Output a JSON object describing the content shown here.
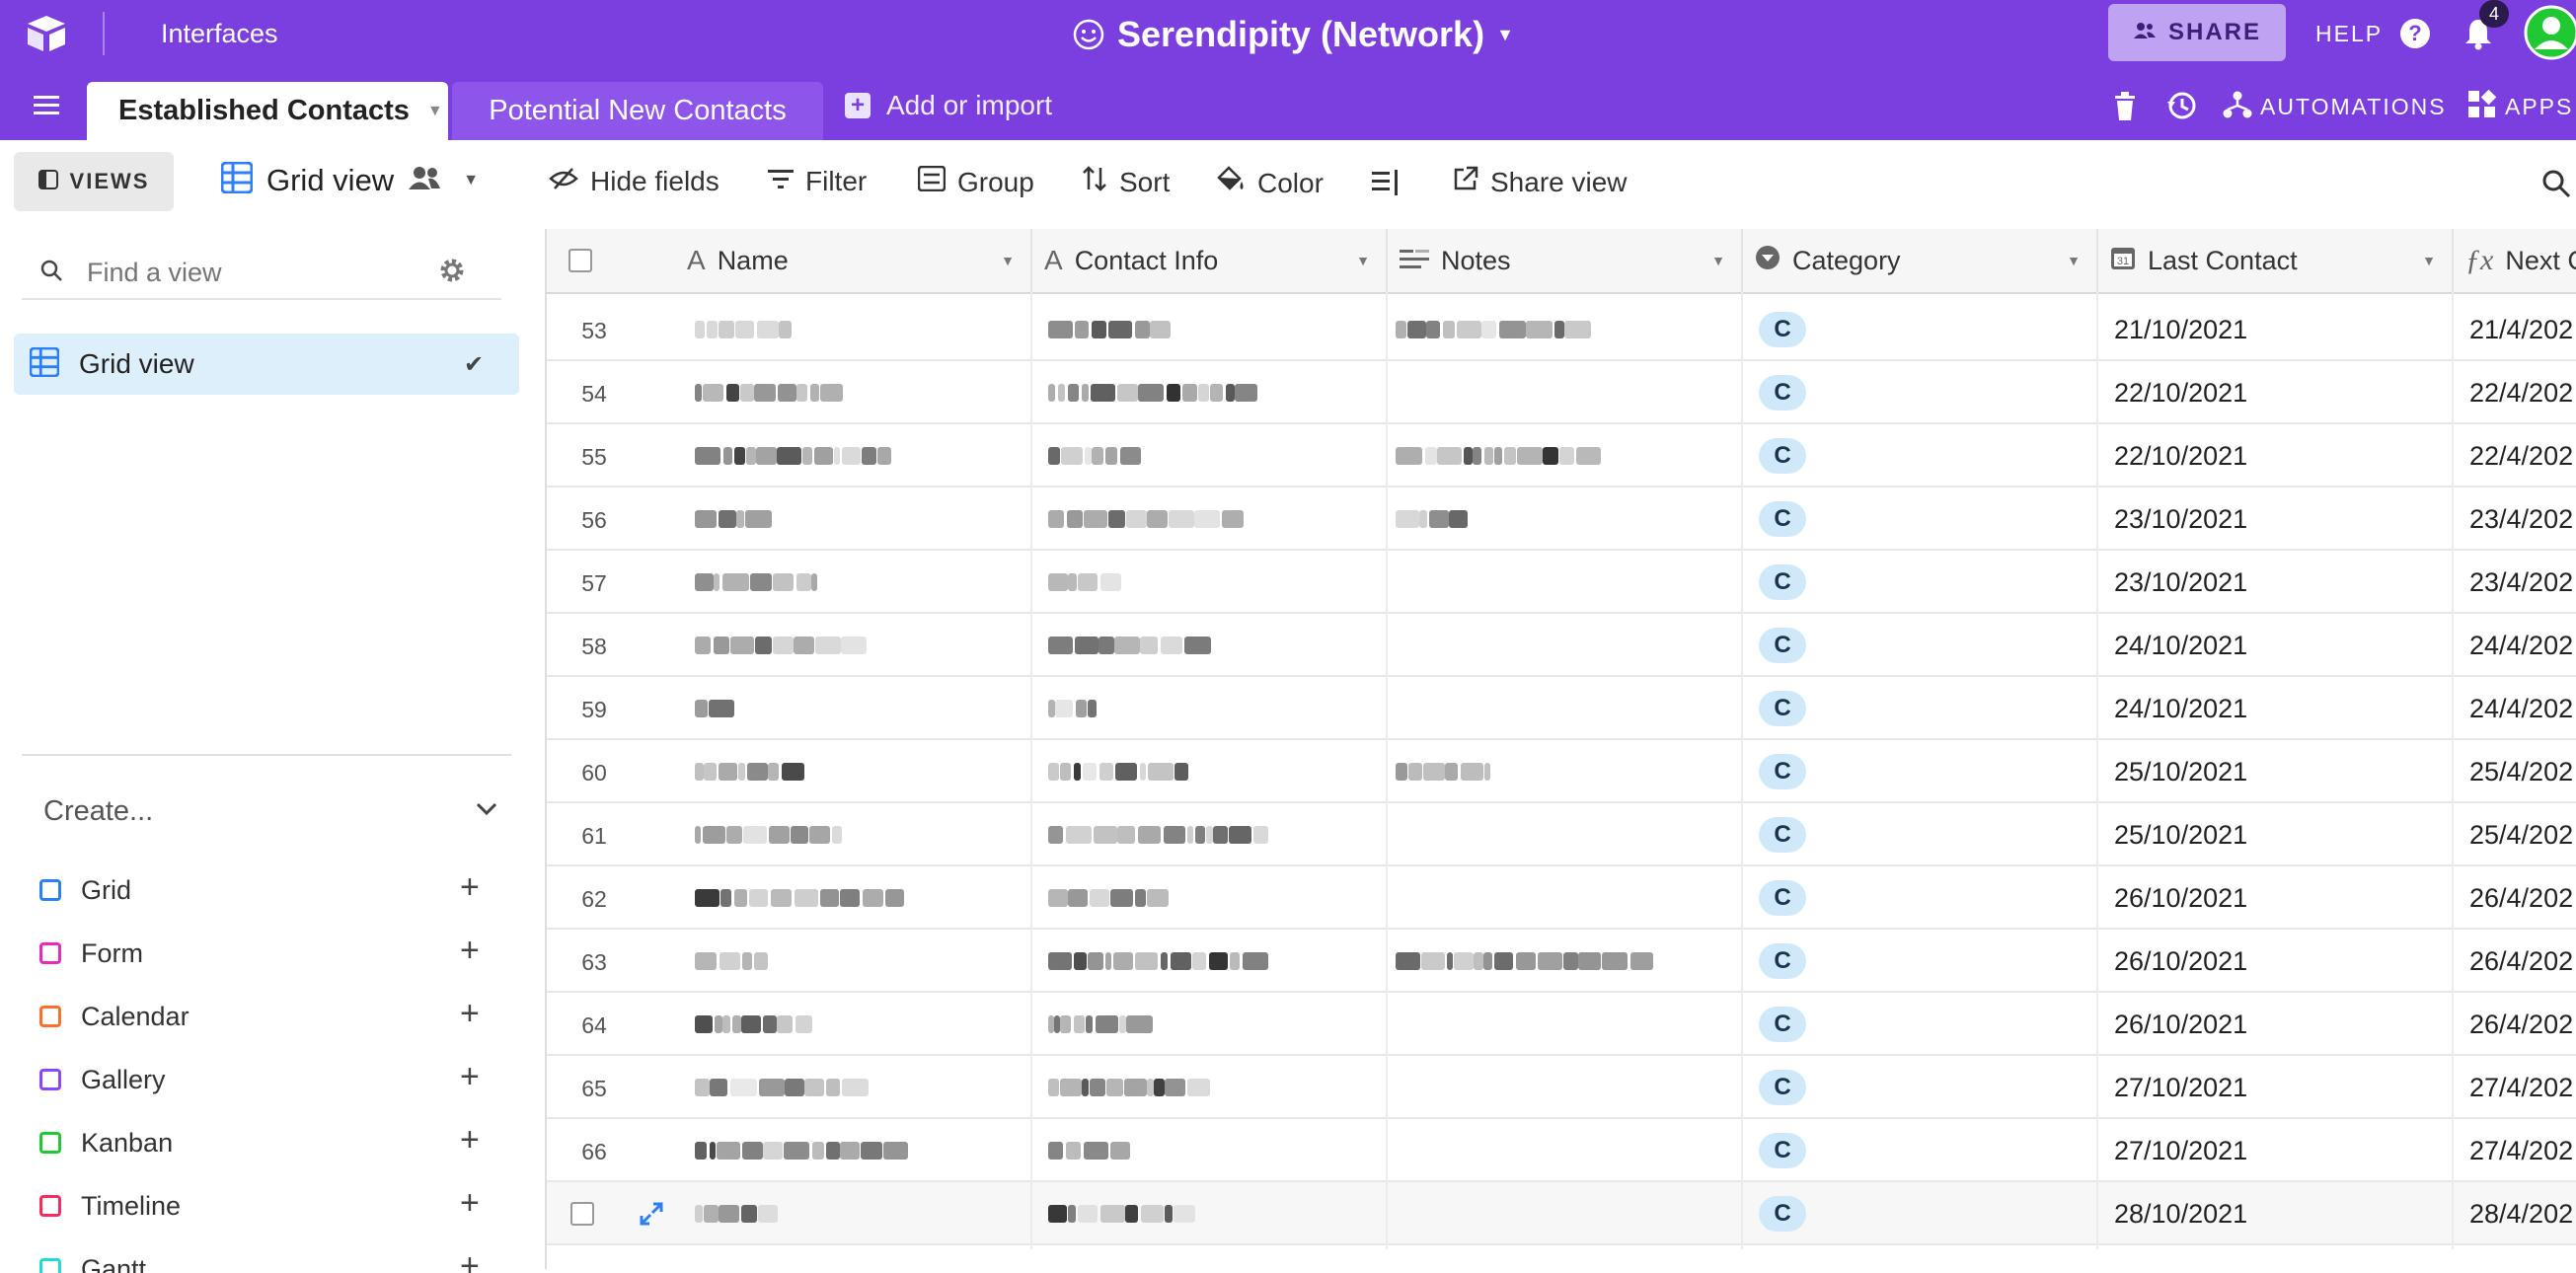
{
  "topbar": {
    "interfaces_label": "Interfaces",
    "base_title": "Serendipity (Network)",
    "share_label": "SHARE",
    "help_label": "HELP",
    "notification_count": "4"
  },
  "tabs": {
    "items": [
      {
        "label": "Established Contacts",
        "active": true
      },
      {
        "label": "Potential New Contacts",
        "active": false
      }
    ],
    "add_label": "Add or import",
    "automations_label": "AUTOMATIONS",
    "apps_label": "APPS"
  },
  "viewbar": {
    "views_label": "VIEWS",
    "current_view": "Grid view",
    "hide_fields": "Hide fields",
    "filter": "Filter",
    "group": "Group",
    "sort": "Sort",
    "color": "Color",
    "share_view": "Share view"
  },
  "sidebar": {
    "find_placeholder": "Find a view",
    "views": [
      {
        "label": "Grid view"
      }
    ],
    "create_label": "Create...",
    "create_items": [
      {
        "label": "Grid",
        "color": "#2d7ff9"
      },
      {
        "label": "Form",
        "color": "#e929ba"
      },
      {
        "label": "Calendar",
        "color": "#ff6f2c"
      },
      {
        "label": "Gallery",
        "color": "#8b46ff"
      },
      {
        "label": "Kanban",
        "color": "#20c933"
      },
      {
        "label": "Timeline",
        "color": "#f82b60"
      },
      {
        "label": "Gantt",
        "color": "#20d9d2"
      }
    ]
  },
  "grid": {
    "columns": [
      "Name",
      "Contact Info",
      "Notes",
      "Category",
      "Last Contact",
      "Next C"
    ],
    "rows": [
      {
        "num": "53",
        "category": "C",
        "last_contact": "21/10/2021",
        "next": "21/4/202"
      },
      {
        "num": "54",
        "category": "C",
        "last_contact": "22/10/2021",
        "next": "22/4/202"
      },
      {
        "num": "55",
        "category": "C",
        "last_contact": "22/10/2021",
        "next": "22/4/202"
      },
      {
        "num": "56",
        "category": "C",
        "last_contact": "23/10/2021",
        "next": "23/4/202"
      },
      {
        "num": "57",
        "category": "C",
        "last_contact": "23/10/2021",
        "next": "23/4/202"
      },
      {
        "num": "58",
        "category": "C",
        "last_contact": "24/10/2021",
        "next": "24/4/202"
      },
      {
        "num": "59",
        "category": "C",
        "last_contact": "24/10/2021",
        "next": "24/4/202"
      },
      {
        "num": "60",
        "category": "C",
        "last_contact": "25/10/2021",
        "next": "25/4/202"
      },
      {
        "num": "61",
        "category": "C",
        "last_contact": "25/10/2021",
        "next": "25/4/202"
      },
      {
        "num": "62",
        "category": "C",
        "last_contact": "26/10/2021",
        "next": "26/4/202"
      },
      {
        "num": "63",
        "category": "C",
        "last_contact": "26/10/2021",
        "next": "26/4/202"
      },
      {
        "num": "64",
        "category": "C",
        "last_contact": "26/10/2021",
        "next": "26/4/202"
      },
      {
        "num": "65",
        "category": "C",
        "last_contact": "27/10/2021",
        "next": "27/4/202"
      },
      {
        "num": "66",
        "category": "C",
        "last_contact": "27/10/2021",
        "next": "27/4/202"
      },
      {
        "num": "",
        "category": "C",
        "last_contact": "28/10/2021",
        "next": "28/4/202"
      }
    ]
  }
}
